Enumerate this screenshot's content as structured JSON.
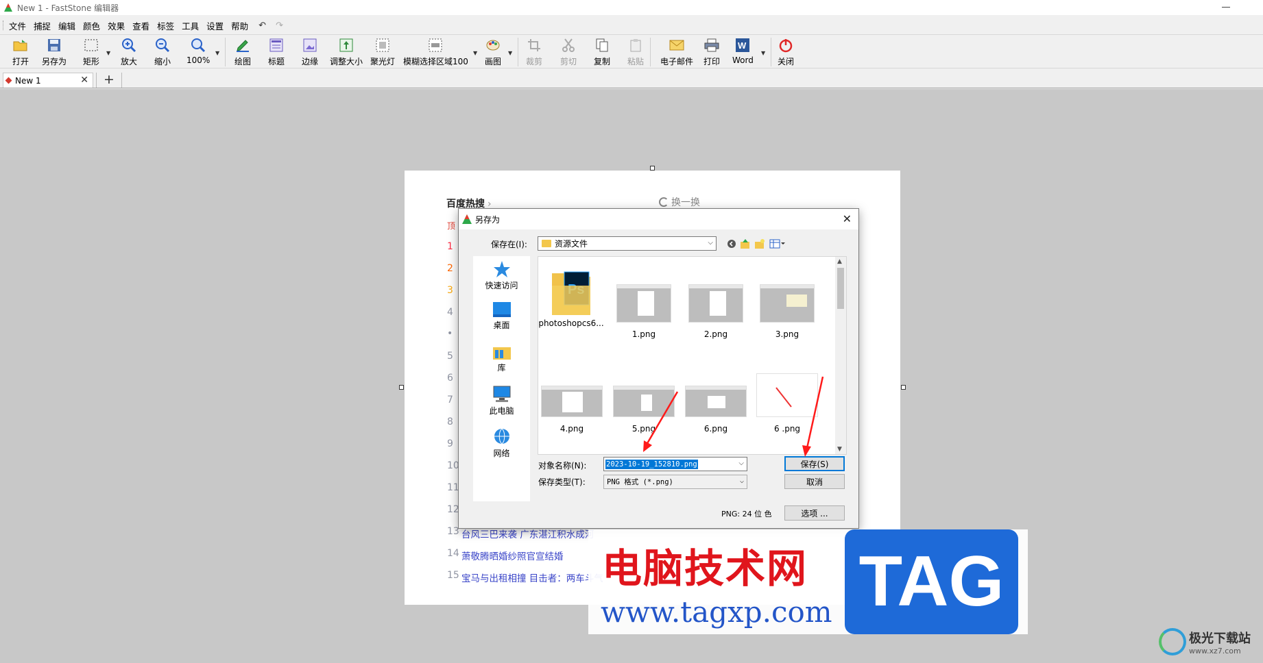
{
  "window": {
    "title": "New 1 - FastStone 编辑器"
  },
  "menu": [
    "文件",
    "捕捉",
    "编辑",
    "颜色",
    "效果",
    "查看",
    "标签",
    "工具",
    "设置",
    "帮助"
  ],
  "toolbar": {
    "open": "打开",
    "save_as": "另存为",
    "rect": "矩形",
    "zoom_in": "放大",
    "zoom_out": "缩小",
    "zoom": "100%",
    "draw": "绘图",
    "caption": "标题",
    "edge": "边缘",
    "resize": "调整大小",
    "spotlight": "聚光灯",
    "blur": "模糊选择区域100",
    "canvas": "画图",
    "crop": "裁剪",
    "cut": "剪切",
    "copy": "复制",
    "paste": "粘贴",
    "email": "电子邮件",
    "print": "打印",
    "word": "Word",
    "close": "关闭"
  },
  "tabs": [
    {
      "label": "New 1"
    }
  ],
  "doc": {
    "hot_title": "百度热搜",
    "refresh": "换一换",
    "top_marker": "顶",
    "rank_numbers": [
      "1",
      "2",
      "3",
      "4",
      "•",
      "5",
      "6",
      "7",
      "8",
      "9",
      "10",
      "11",
      "12"
    ],
    "items": [
      {
        "rank": "13",
        "text": "台风三巴来袭 广东湛江积水成河"
      },
      {
        "rank": "14",
        "text": "萧敬腾晒婚纱照官宣结婚"
      },
      {
        "rank": "15",
        "text": "宝马与出租相撞 目击者：两车斗气"
      }
    ]
  },
  "dialog": {
    "title": "另存为",
    "save_in_label": "保存在(I):",
    "save_in_value": "资源文件",
    "places": [
      "快速访问",
      "桌面",
      "库",
      "此电脑",
      "网络"
    ],
    "files": [
      "photoshopcs6...",
      "1.png",
      "2.png",
      "3.png",
      "4.png",
      "5.png",
      "6.png",
      "6 .png"
    ],
    "filename_label": "对象名称(N):",
    "filename_value": "2023-10-19_152810.png",
    "filetype_label": "保存类型(T):",
    "filetype_value": "PNG 格式 (*.png)",
    "save_button": "保存(S)",
    "cancel_button": "取消",
    "options_button": "选项 ...",
    "info": "PNG: 24 位 色"
  },
  "watermark": {
    "site_name": "电脑技术网",
    "url": "www.tagxp.com",
    "tag": "TAG",
    "corner_name": "极光下载站",
    "corner_url": "www.xz7.com"
  },
  "colors": {
    "accent": "#0078d7",
    "arrow": "#ff1a1a",
    "canvas": "#c8c8c8",
    "watermark_red": "#e0151c",
    "watermark_blue": "#1e6ad8"
  }
}
